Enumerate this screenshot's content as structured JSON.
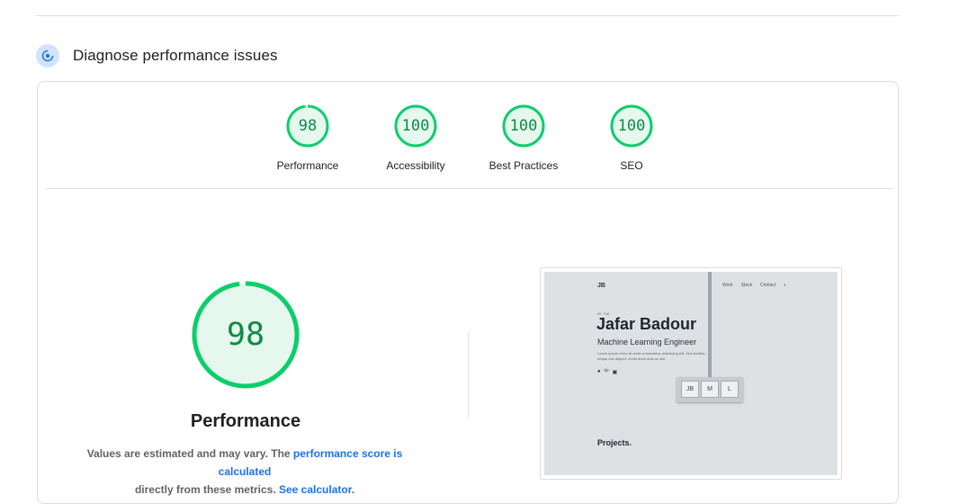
{
  "section": {
    "title": "Diagnose performance issues",
    "icon": "gauge-icon"
  },
  "scores": [
    {
      "label": "Performance",
      "score": 98
    },
    {
      "label": "Accessibility",
      "score": 100
    },
    {
      "label": "Best Practices",
      "score": 100
    },
    {
      "label": "SEO",
      "score": 100
    }
  ],
  "summary": {
    "score": 98,
    "title": "Performance",
    "note_prefix": "Values are estimated and may vary. The ",
    "note_link1": "performance score is calculated",
    "note_middle": " directly from these metrics. ",
    "note_link2": "See calculator."
  },
  "screenshot": {
    "logo": "JB",
    "nav": [
      "Work",
      "Stack",
      "Contact"
    ],
    "greeting": "HI I'M",
    "name": "Jafar Badour",
    "role": "Machine Learning Engineer",
    "description": "Lorem ipsum dolor sit amet consectetur, adipiscing elit. Sed facilisis, neque non aliquet, morbi dolor duis ac nisl.",
    "keys": [
      "JB",
      "M",
      "L"
    ],
    "projects": "Projects."
  },
  "colors": {
    "pass": "#0cce6b",
    "pass_text": "#0d8a43",
    "pass_fill": "#e6f8ee",
    "link": "#1a73e8"
  }
}
